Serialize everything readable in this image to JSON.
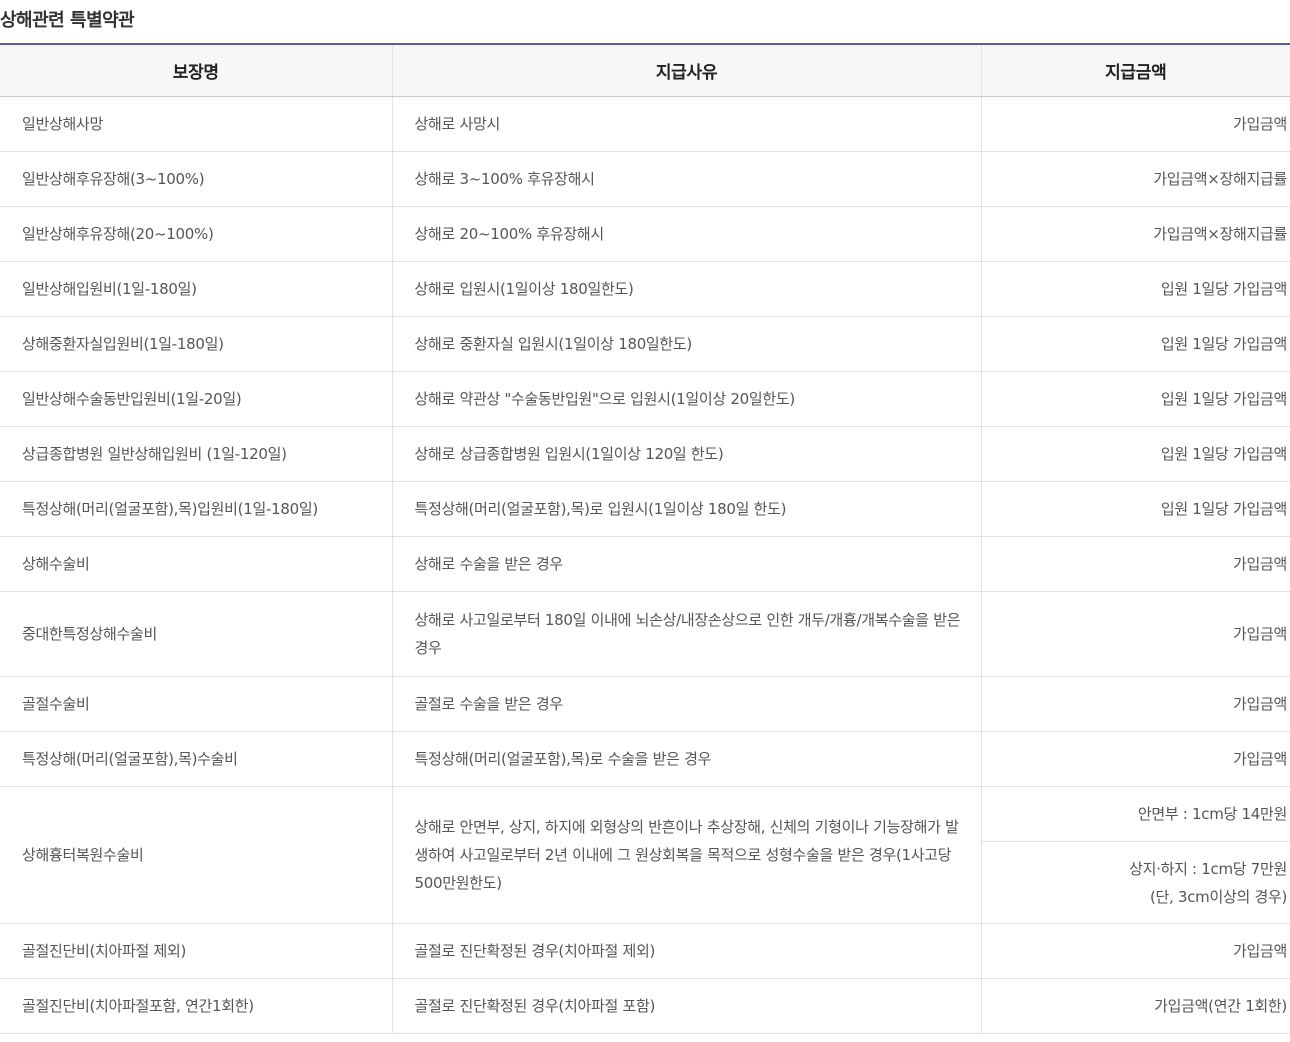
{
  "title": "상해관련 특별약관",
  "table": {
    "headers": [
      "보장명",
      "지급사유",
      "지급금액"
    ],
    "rows": [
      {
        "name": "일반상해사망",
        "reason": "상해로 사망시",
        "amount": "가입금액"
      },
      {
        "name": "일반상해후유장해(3~100%)",
        "reason": "상해로 3~100% 후유장해시",
        "amount": "가입금액×장해지급률"
      },
      {
        "name": "일반상해후유장해(20~100%)",
        "reason": "상해로 20~100% 후유장해시",
        "amount": "가입금액×장해지급률"
      },
      {
        "name": "일반상해입원비(1일-180일)",
        "reason": "상해로 입원시(1일이상 180일한도)",
        "amount": "입원 1일당 가입금액"
      },
      {
        "name": "상해중환자실입원비(1일-180일)",
        "reason": "상해로 중환자실 입원시(1일이상 180일한도)",
        "amount": "입원 1일당 가입금액"
      },
      {
        "name": "일반상해수술동반입원비(1일-20일)",
        "reason": "상해로 약관상 \"수술동반입원\"으로 입원시(1일이상 20일한도)",
        "amount": "입원 1일당 가입금액"
      },
      {
        "name": "상급종합병원 일반상해입원비 (1일-120일)",
        "reason": "상해로 상급종합병원 입원시(1일이상 120일 한도)",
        "amount": "입원 1일당 가입금액"
      },
      {
        "name": "특정상해(머리(얼굴포함),목)입원비(1일-180일)",
        "reason": "특정상해(머리(얼굴포함),목)로 입원시(1일이상 180일 한도)",
        "amount": "입원 1일당 가입금액"
      },
      {
        "name": "상해수술비",
        "reason": "상해로 수술을 받은 경우",
        "amount": "가입금액"
      },
      {
        "name": "중대한특정상해수술비",
        "reason": "상해로 사고일로부터 180일 이내에 뇌손상/내장손상으로 인한 개두/개흉/개복수술을 받은 경우",
        "amount": "가입금액"
      },
      {
        "name": "골절수술비",
        "reason": "골절로 수술을 받은 경우",
        "amount": "가입금액"
      },
      {
        "name": "특정상해(머리(얼굴포함),목)수술비",
        "reason": "특정상해(머리(얼굴포함),목)로 수술을 받은 경우",
        "amount": "가입금액"
      },
      {
        "name": "상해흉터복원수술비",
        "reason": "상해로 안면부, 상지, 하지에 외형상의 반흔이나 추상장해, 신체의 기형이나 기능장해가 발생하여 사고일로부터 2년 이내에 그 원상회복을 목적으로 성형수술을 받은 경우(1사고당 500만원한도)",
        "amount_face": "안면부 : 1cm당 14만원",
        "amount_limb": "상지·하지 : 1cm당 7만원",
        "amount_note": "(단, 3cm이상의 경우)"
      },
      {
        "name": "골절진단비(치아파절 제외)",
        "reason": "골절로 진단확정된 경우(치아파절 제외)",
        "amount": "가입금액"
      },
      {
        "name": "골절진단비(치아파절포함, 연간1회한)",
        "reason": "골절로 진단확정된 경우(치아파절 포함)",
        "amount": "가입금액(연간 1회한)"
      }
    ]
  }
}
